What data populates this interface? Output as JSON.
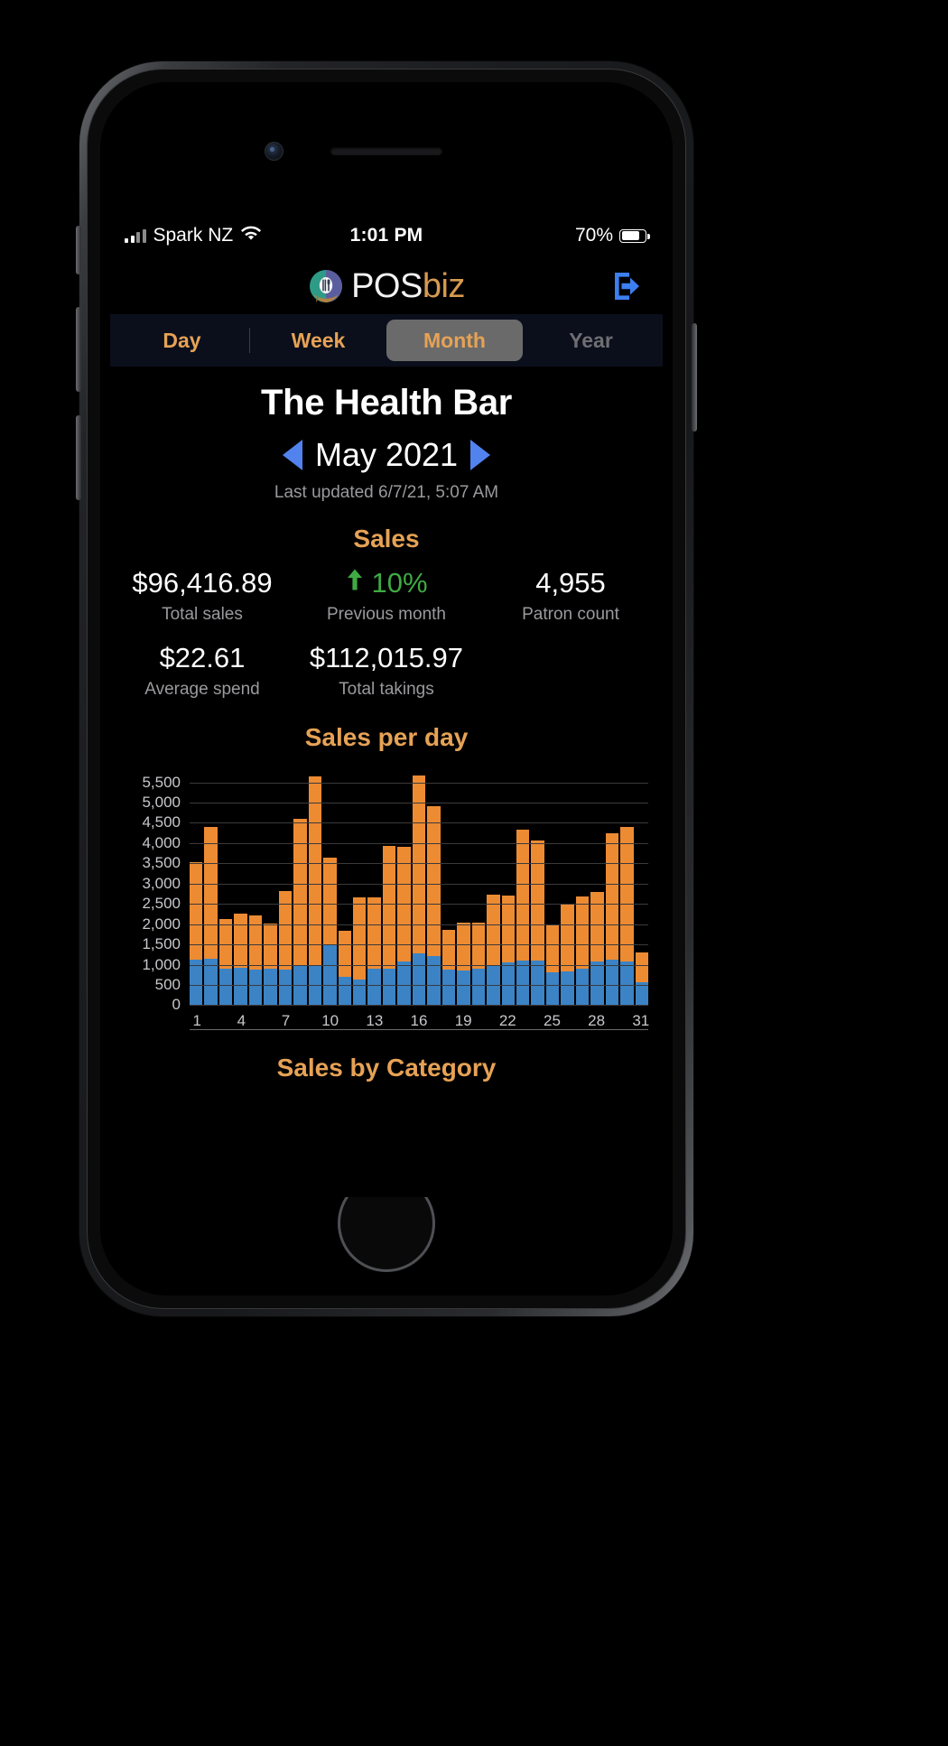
{
  "statusbar": {
    "carrier": "Spark NZ",
    "time": "1:01 PM",
    "battery_pct": "70%",
    "signal_icon": "cellular-signal-icon",
    "wifi_icon": "wifi-icon",
    "battery_icon": "battery-icon"
  },
  "header": {
    "logo_primary": "POS",
    "logo_accent": "biz",
    "logo_mark_icon": "posbiz-logo-icon",
    "logout_icon": "logout-icon"
  },
  "tabs": [
    {
      "label": "Day",
      "active": false,
      "muted": false
    },
    {
      "label": "Week",
      "active": false,
      "muted": false
    },
    {
      "label": "Month",
      "active": true,
      "muted": false
    },
    {
      "label": "Year",
      "active": false,
      "muted": true
    }
  ],
  "venue": {
    "name": "The Health Bar"
  },
  "date_nav": {
    "prev_icon": "previous-period-arrow-icon",
    "next_icon": "next-period-arrow-icon",
    "label": "May 2021",
    "last_updated": "Last updated 6/7/21, 5:07 AM"
  },
  "sales": {
    "title": "Sales",
    "stats_row1": [
      {
        "value": "$96,416.89",
        "label": "Total sales",
        "accent": false
      },
      {
        "value": "10%",
        "label": "Previous month",
        "accent": true,
        "trend_icon": "trend-up-arrow-icon"
      },
      {
        "value": "4,955",
        "label": "Patron count",
        "accent": false
      }
    ],
    "stats_row2": [
      {
        "value": "$22.61",
        "label": "Average spend",
        "accent": false
      },
      {
        "value": "$112,015.97",
        "label": "Total takings",
        "accent": false
      }
    ]
  },
  "next_section": {
    "title": "Sales by Category"
  },
  "colors": {
    "accent_orange": "#e6a255",
    "bar_orange": "#ed8b33",
    "bar_blue": "#3b83c4",
    "positive_green": "#3faa43",
    "arrow_blue": "#5182ee",
    "tabbar_bg": "#0b0f1c",
    "tab_active_bg": "#6a6a6a"
  },
  "chart_data": {
    "type": "bar",
    "title": "Sales per day",
    "stacked": true,
    "xlabel": "",
    "ylabel": "",
    "ylim": [
      0,
      5750
    ],
    "yticks": [
      0,
      500,
      1000,
      1500,
      2000,
      2500,
      3000,
      3500,
      4000,
      4500,
      5000,
      5500
    ],
    "ytick_labels": [
      "0",
      "500",
      "1,000",
      "1,500",
      "2,000",
      "2,500",
      "3,000",
      "3,500",
      "4,000",
      "4,500",
      "5,000",
      "5,500"
    ],
    "grid": true,
    "legend": null,
    "categories": [
      1,
      2,
      3,
      4,
      5,
      6,
      7,
      8,
      9,
      10,
      11,
      12,
      13,
      14,
      15,
      16,
      17,
      18,
      19,
      20,
      21,
      22,
      23,
      24,
      25,
      26,
      27,
      28,
      29,
      30,
      31
    ],
    "xtick_labels": [
      "1",
      "4",
      "7",
      "10",
      "13",
      "16",
      "19",
      "22",
      "25",
      "28",
      "31"
    ],
    "series": [
      {
        "name": "lower-blue",
        "values": [
          1120,
          1150,
          900,
          920,
          880,
          900,
          870,
          1000,
          1000,
          1510,
          700,
          630,
          900,
          900,
          1080,
          1280,
          1220,
          880,
          860,
          900,
          1000,
          1060,
          1100,
          1100,
          800,
          840,
          900,
          1080,
          1130,
          1070,
          560
        ]
      },
      {
        "name": "upper-orange",
        "values": [
          2400,
          3260,
          1230,
          1340,
          1330,
          1110,
          1940,
          3610,
          4640,
          2140,
          1140,
          2030,
          1750,
          3040,
          2820,
          4400,
          3700,
          980,
          1180,
          1130,
          1720,
          1640,
          3240,
          2970,
          1180,
          1660,
          1780,
          1720,
          3120,
          3320,
          750
        ]
      }
    ],
    "totals": [
      3520,
      4410,
      2130,
      2260,
      2210,
      2010,
      2810,
      4610,
      5640,
      3650,
      1840,
      2660,
      2650,
      3940,
      3900,
      5680,
      4920,
      1860,
      2040,
      2030,
      2720,
      2700,
      4340,
      4070,
      1980,
      2500,
      2680,
      2800,
      4250,
      4390,
      1310
    ]
  }
}
